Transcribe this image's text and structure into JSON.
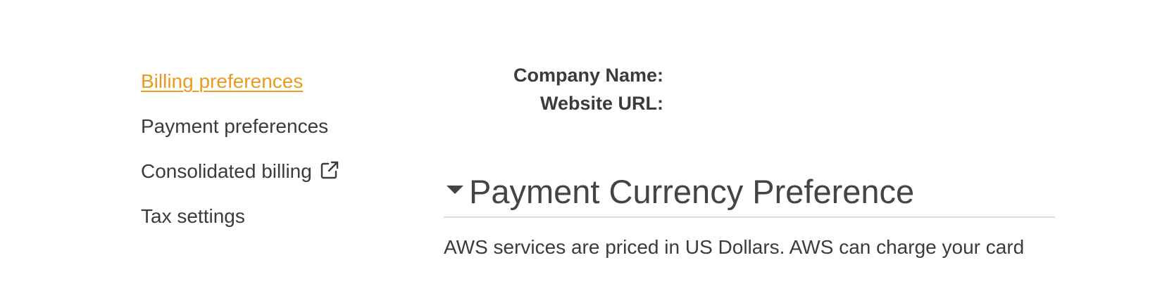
{
  "sidebar": {
    "items": [
      {
        "label": "Billing preferences",
        "active": true
      },
      {
        "label": "Payment preferences",
        "active": false
      },
      {
        "label": "Consolidated billing",
        "active": false,
        "icon": "external-link-icon"
      },
      {
        "label": "Tax settings",
        "active": false
      }
    ]
  },
  "contact_info": {
    "company_name_label": "Company Name:",
    "website_url_label": "Website URL:"
  },
  "payment_currency": {
    "title": "Payment Currency Preference",
    "description": "AWS services are priced in US Dollars. AWS can charge your card"
  },
  "colors": {
    "active_link": "#ec9a1e",
    "text": "#3b3b3b",
    "divider": "#dddddd"
  }
}
